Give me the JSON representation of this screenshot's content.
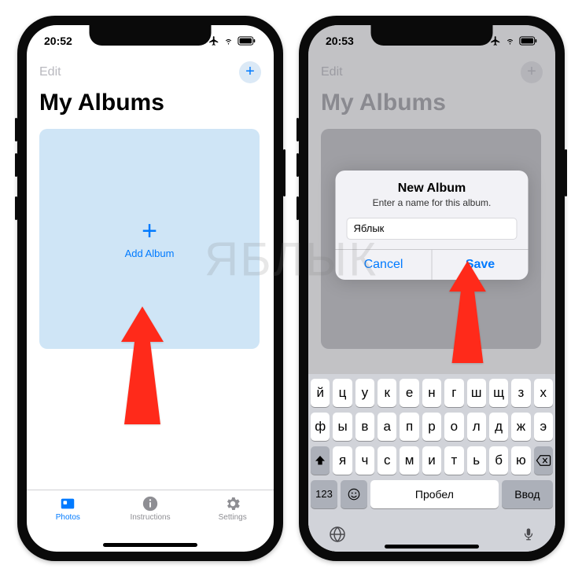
{
  "watermark_text": "ЯБЛЫК",
  "left": {
    "status": {
      "time": "20:52"
    },
    "nav": {
      "edit_label": "Edit",
      "plus_glyph": "+"
    },
    "title": "My Albums",
    "add_tile": {
      "plus_glyph": "+",
      "label": "Add Album"
    },
    "tabs": [
      {
        "label": "Photos",
        "active": true
      },
      {
        "label": "Instructions",
        "active": false
      },
      {
        "label": "Settings",
        "active": false
      }
    ]
  },
  "right": {
    "status": {
      "time": "20:53"
    },
    "nav": {
      "edit_label": "Edit",
      "plus_glyph": "+"
    },
    "title": "My Albums",
    "dialog": {
      "title": "New Album",
      "subtitle": "Enter a name for this album.",
      "input_value": "Яблык",
      "cancel_label": "Cancel",
      "save_label": "Save"
    },
    "keyboard": {
      "row1": [
        "й",
        "ц",
        "у",
        "к",
        "е",
        "н",
        "г",
        "ш",
        "щ",
        "з",
        "х"
      ],
      "row2": [
        "ф",
        "ы",
        "в",
        "а",
        "п",
        "р",
        "о",
        "л",
        "д",
        "ж",
        "э"
      ],
      "row3": [
        "я",
        "ч",
        "с",
        "м",
        "и",
        "т",
        "ь",
        "б",
        "ю"
      ],
      "numbers_key": "123",
      "space_label": "Пробел",
      "return_label": "Ввод"
    }
  }
}
